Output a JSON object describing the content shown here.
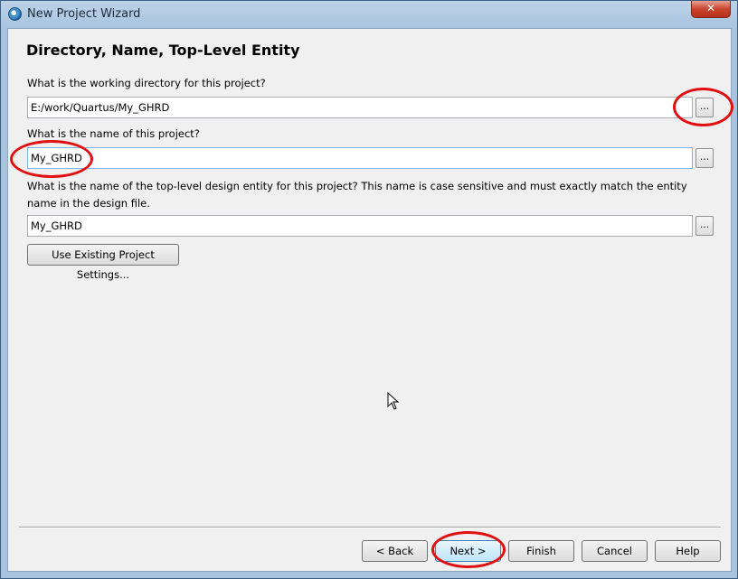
{
  "window": {
    "title": "New Project Wizard",
    "close_glyph": "✕"
  },
  "page": {
    "heading": "Directory, Name, Top-Level Entity",
    "working_dir": {
      "label": "What is the working directory for this project?",
      "value": "E:/work/Quartus/My_GHRD",
      "browse": "..."
    },
    "project_name": {
      "label": "What is the name of this project?",
      "value": "My_GHRD",
      "browse": "..."
    },
    "top_level": {
      "label": "What is the name of the top-level design entity for this project? This name is case sensitive and must exactly match the entity name in the design file.",
      "value": "My_GHRD",
      "browse": "..."
    },
    "use_existing": "Use Existing Project Settings..."
  },
  "buttons": {
    "back": "< Back",
    "next": "Next >",
    "finish": "Finish",
    "cancel": "Cancel",
    "help": "Help"
  },
  "colors": {
    "annotation": "#e01010",
    "titlebar": "#bcd3e9",
    "client_bg": "#f0f0f0"
  }
}
